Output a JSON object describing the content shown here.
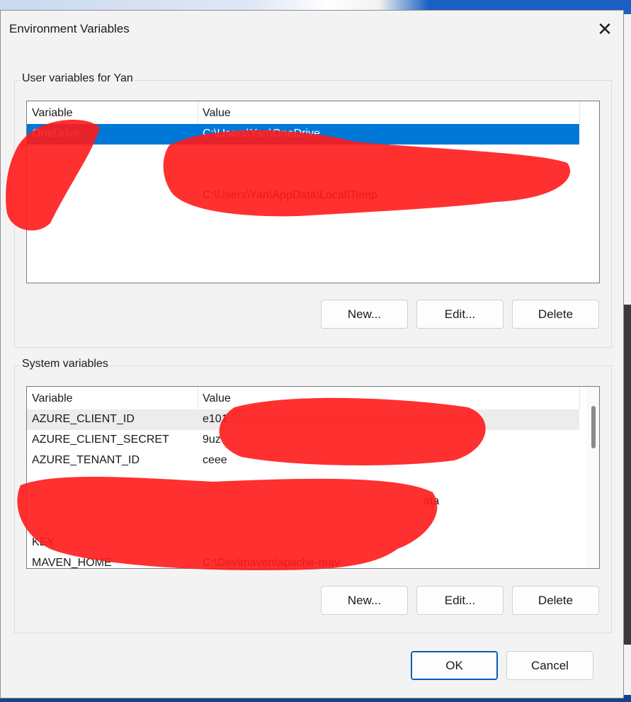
{
  "window": {
    "title": "Environment Variables"
  },
  "user_group": {
    "label": "User variables for Yan",
    "columns": [
      "Variable",
      "Value"
    ],
    "rows": [
      {
        "variable": "OneDrive",
        "value": "C:\\Users\\Yan\\OneDrive",
        "selected": true
      },
      {
        "variable": "",
        "value": ""
      },
      {
        "variable": "",
        "value": ""
      },
      {
        "variable": "",
        "value": "C:\\Users\\Yan\\AppData\\Local\\Temp"
      }
    ],
    "buttons": {
      "new": "New...",
      "edit": "Edit...",
      "delete": "Delete"
    }
  },
  "system_group": {
    "label": "System variables",
    "columns": [
      "Variable",
      "Value"
    ],
    "rows": [
      {
        "variable": "AZURE_CLIENT_ID",
        "value": "e101"
      },
      {
        "variable": "AZURE_CLIENT_SECRET",
        "value": "9uz"
      },
      {
        "variable": "AZURE_TENANT_ID",
        "value": "ceee"
      },
      {
        "variable": "",
        "value": ""
      },
      {
        "variable": "",
        "value": "ata"
      },
      {
        "variable": "",
        "value": ""
      },
      {
        "variable": "KEY",
        "value": ""
      },
      {
        "variable": "MAVEN_HOME",
        "value": "C:\\Dev\\maven\\apache-mav"
      }
    ],
    "buttons": {
      "new": "New...",
      "edit": "Edit...",
      "delete": "Delete"
    }
  },
  "footer": {
    "ok": "OK",
    "cancel": "Cancel"
  },
  "colors": {
    "selection": "#0078d7",
    "redaction": "#ff0000",
    "default_button_border": "#005fb8"
  },
  "icons": {
    "close": "close-icon"
  }
}
